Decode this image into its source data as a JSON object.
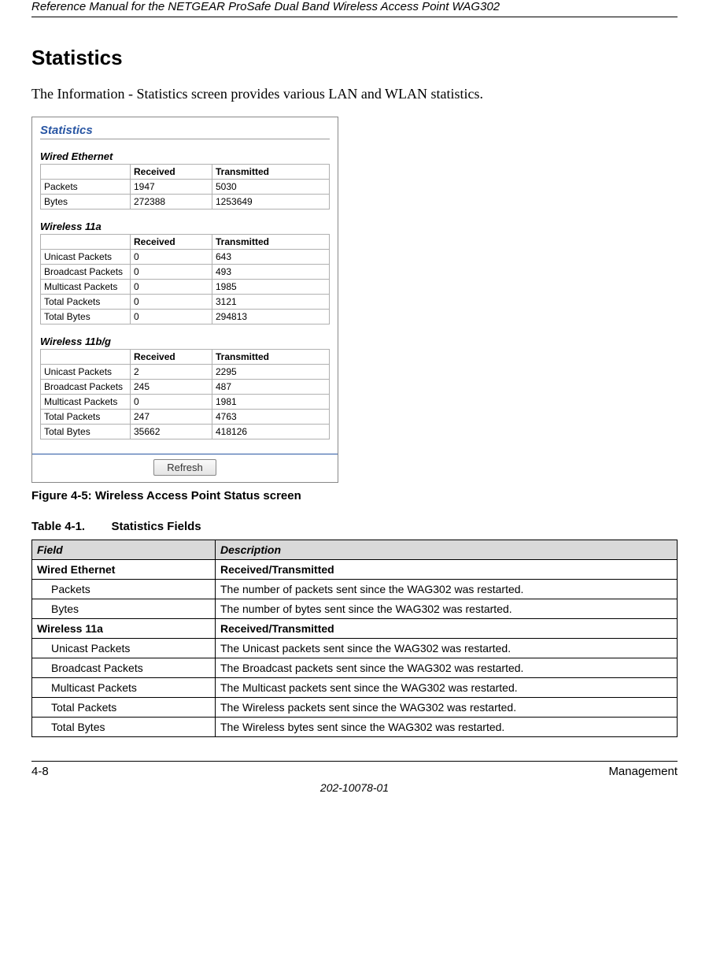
{
  "header": "Reference Manual for the NETGEAR ProSafe Dual Band Wireless Access Point WAG302",
  "title": "Statistics",
  "intro": "The Information - Statistics screen provides various LAN and WLAN statistics.",
  "screenshot": {
    "title": "Statistics",
    "refresh": "Refresh",
    "columns": {
      "blank": "",
      "received": "Received",
      "transmitted": "Transmitted"
    },
    "sections": {
      "wired": {
        "label": "Wired Ethernet",
        "rows": [
          {
            "name": "Packets",
            "rx": "1947",
            "tx": "5030"
          },
          {
            "name": "Bytes",
            "rx": "272388",
            "tx": "1253649"
          }
        ]
      },
      "w11a": {
        "label": "Wireless 11a",
        "rows": [
          {
            "name": "Unicast Packets",
            "rx": "0",
            "tx": "643"
          },
          {
            "name": "Broadcast Packets",
            "rx": "0",
            "tx": "493"
          },
          {
            "name": "Multicast Packets",
            "rx": "0",
            "tx": "1985"
          },
          {
            "name": "Total Packets",
            "rx": "0",
            "tx": "3121"
          },
          {
            "name": "Total Bytes",
            "rx": "0",
            "tx": "294813"
          }
        ]
      },
      "w11bg": {
        "label": "Wireless 11b/g",
        "rows": [
          {
            "name": "Unicast Packets",
            "rx": "2",
            "tx": "2295"
          },
          {
            "name": "Broadcast Packets",
            "rx": "245",
            "tx": "487"
          },
          {
            "name": "Multicast Packets",
            "rx": "0",
            "tx": "1981"
          },
          {
            "name": "Total Packets",
            "rx": "247",
            "tx": "4763"
          },
          {
            "name": "Total Bytes",
            "rx": "35662",
            "tx": "418126"
          }
        ]
      }
    }
  },
  "figure_caption": "Figure 4-5:  Wireless Access Point Status screen",
  "table_caption_prefix": "Table 4-1.",
  "table_caption_title": "Statistics Fields",
  "fields_table": {
    "headers": {
      "field": "Field",
      "desc": "Description"
    },
    "rows": [
      {
        "field": "Wired Ethernet",
        "desc": "Received/Transmitted",
        "bold": true,
        "indent": false
      },
      {
        "field": "Packets",
        "desc": "The number of packets sent since the WAG302 was restarted.",
        "bold": false,
        "indent": true
      },
      {
        "field": "Bytes",
        "desc": "The number of bytes sent since the WAG302 was restarted.",
        "bold": false,
        "indent": true
      },
      {
        "field": "Wireless 11a",
        "desc": "Received/Transmitted",
        "bold": true,
        "indent": false
      },
      {
        "field": "Unicast Packets",
        "desc": "The Unicast packets sent since the WAG302 was restarted.",
        "bold": false,
        "indent": true
      },
      {
        "field": "Broadcast Packets",
        "desc": "The Broadcast packets sent since the WAG302 was restarted.",
        "bold": false,
        "indent": true
      },
      {
        "field": "Multicast Packets",
        "desc": "The Multicast packets sent since the WAG302 was restarted.",
        "bold": false,
        "indent": true
      },
      {
        "field": "Total Packets",
        "desc": "The Wireless packets sent since the WAG302 was restarted.",
        "bold": false,
        "indent": true
      },
      {
        "field": "Total Bytes",
        "desc": "The Wireless bytes sent since the WAG302 was restarted.",
        "bold": false,
        "indent": true
      }
    ]
  },
  "footer": {
    "left": "4-8",
    "right": "Management",
    "center": "202-10078-01"
  }
}
